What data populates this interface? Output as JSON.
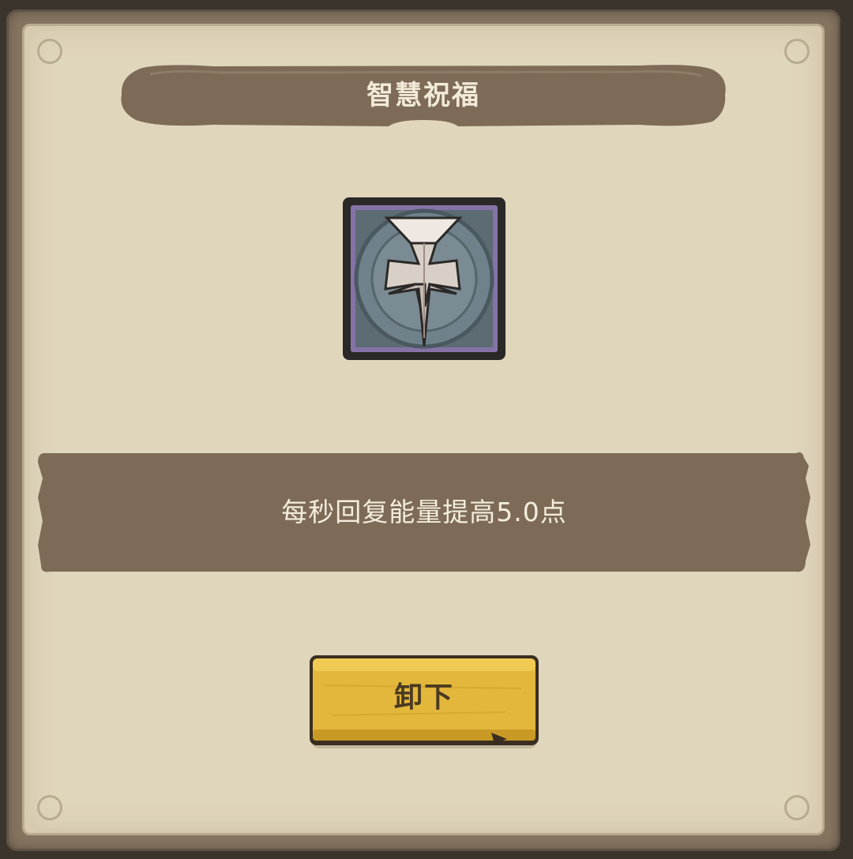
{
  "dialog": {
    "title": "智慧祝福",
    "description": "每秒回复能量提高5.0点",
    "unequip_label": "卸下",
    "icon_name": "cross-blessing-icon"
  },
  "colors": {
    "paper": "#e0d6bc",
    "frame": "#867560",
    "banner": "#7d6b57",
    "button": "#e3b73c"
  }
}
